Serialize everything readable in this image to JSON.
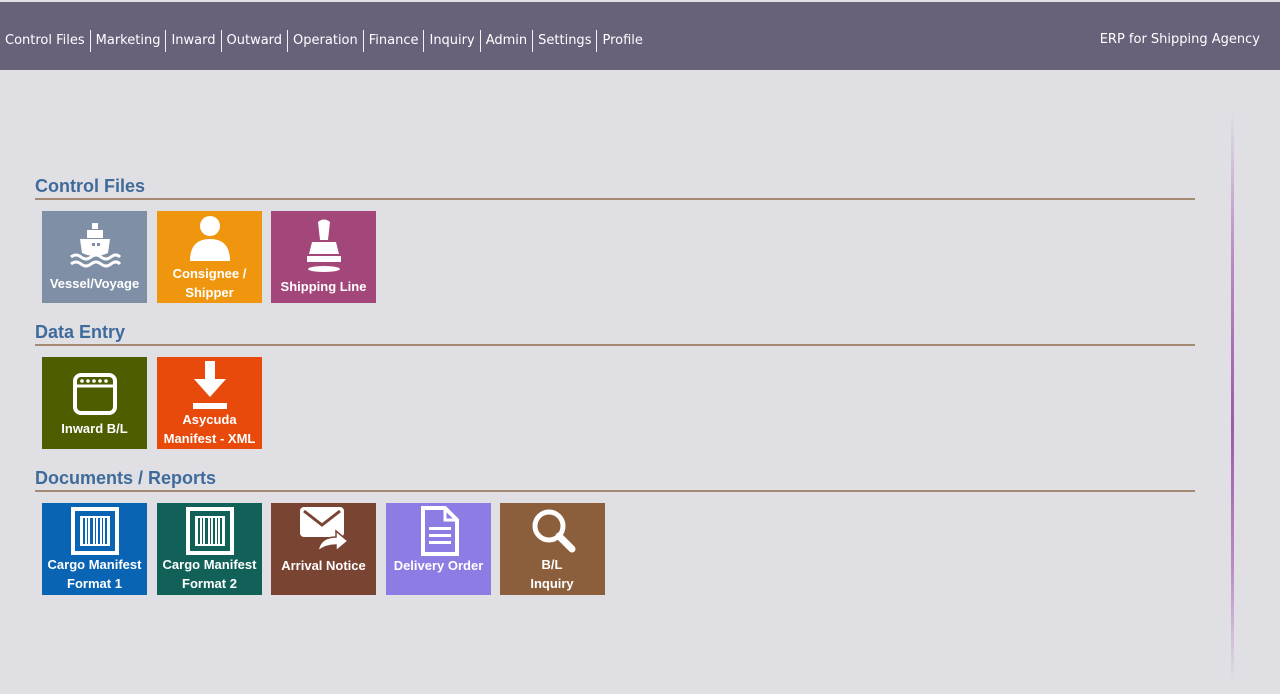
{
  "nav": {
    "items": [
      "Control Files",
      "Marketing",
      "Inward",
      "Outward",
      "Operation",
      "Finance",
      "Inquiry",
      "Admin",
      "Settings",
      "Profile"
    ],
    "brand": "ERP for Shipping Agency"
  },
  "sections": {
    "control_files": {
      "title": "Control Files",
      "tiles": [
        {
          "label": "Vessel/Voyage",
          "icon": "ship-icon",
          "color": "#7f8fa6"
        },
        {
          "label": "Consignee / Shipper",
          "icon": "user-icon",
          "color": "#f0960e"
        },
        {
          "label": "Shipping Line",
          "icon": "stamp-icon",
          "color": "#a3467a"
        }
      ]
    },
    "data_entry": {
      "title": "Data Entry",
      "tiles": [
        {
          "label": "Inward B/L",
          "icon": "window-icon",
          "color": "#4d5d00"
        },
        {
          "label": "Asycuda Manifest - XML",
          "icon": "download-icon",
          "color": "#e84a0c"
        }
      ]
    },
    "documents_reports": {
      "title": "Documents / Reports",
      "tiles": [
        {
          "label": "Cargo Manifest Format 1",
          "icon": "barcode-icon",
          "color": "#0a64b4"
        },
        {
          "label": "Cargo Manifest Format 2",
          "icon": "barcode-icon",
          "color": "#116159"
        },
        {
          "label": "Arrival Notice",
          "icon": "mail-forward-icon",
          "color": "#7a4433"
        },
        {
          "label": "Delivery Order",
          "icon": "document-icon",
          "color": "#8c7ce4"
        },
        {
          "label": "B/L Inquiry",
          "icon": "search-icon",
          "color": "#8b5e3c"
        }
      ]
    }
  }
}
